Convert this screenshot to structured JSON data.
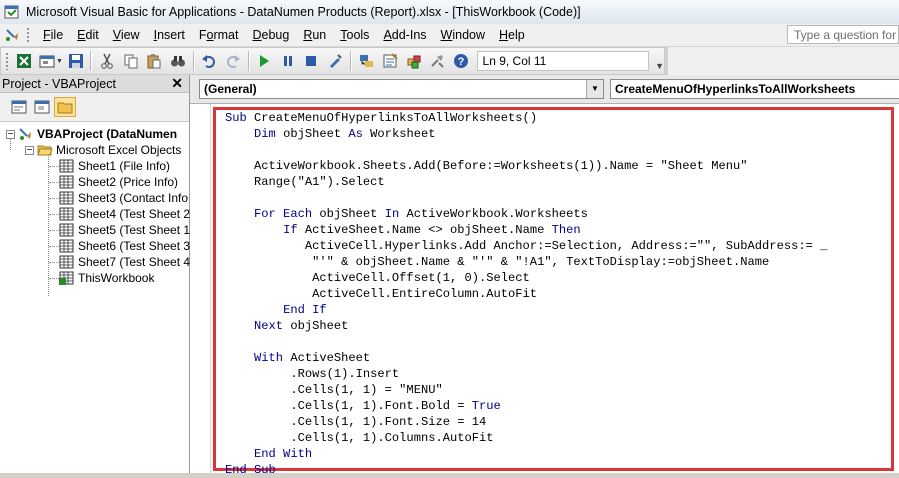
{
  "window": {
    "title": "Microsoft Visual Basic for Applications - DataNumen Products (Report).xlsx - [ThisWorkbook (Code)]",
    "app_icon": "vba-icon"
  },
  "menu": {
    "items": [
      {
        "id": "file",
        "label": "File",
        "u": "F",
        "rest": "ile"
      },
      {
        "id": "edit",
        "label": "Edit",
        "u": "E",
        "rest": "dit"
      },
      {
        "id": "view",
        "label": "View",
        "u": "V",
        "rest": "iew"
      },
      {
        "id": "insert",
        "label": "Insert",
        "u": "I",
        "rest": "nsert"
      },
      {
        "id": "format",
        "label": "Format",
        "u": "o",
        "pre": "F",
        "rest": "rmat"
      },
      {
        "id": "debug",
        "label": "Debug",
        "u": "D",
        "rest": "ebug"
      },
      {
        "id": "run",
        "label": "Run",
        "u": "R",
        "rest": "un"
      },
      {
        "id": "tools",
        "label": "Tools",
        "u": "T",
        "rest": "ools"
      },
      {
        "id": "addins",
        "label": "Add-Ins",
        "u": "A",
        "rest": "dd-Ins"
      },
      {
        "id": "window",
        "label": "Window",
        "u": "W",
        "rest": "indow"
      },
      {
        "id": "help",
        "label": "Help",
        "u": "H",
        "rest": "elp"
      }
    ],
    "ask_placeholder": "Type a question for"
  },
  "toolbar": {
    "position": "Ln 9, Col 11",
    "icons": [
      "view-excel-icon",
      "insert-userform-icon",
      "save-icon",
      "cut-icon",
      "copy-icon",
      "paste-icon",
      "find-icon",
      "undo-icon",
      "redo-icon",
      "run-icon",
      "break-icon",
      "reset-icon",
      "design-mode-icon",
      "project-explorer-icon",
      "properties-icon",
      "object-browser-icon",
      "toolbox-icon",
      "help-icon"
    ]
  },
  "project_panel": {
    "title": "Project - VBAProject",
    "close": "✕",
    "tree": {
      "root": "VBAProject (DataNumen",
      "folder": "Microsoft Excel Objects",
      "items": [
        "Sheet1 (File Info)",
        "Sheet2 (Price Info)",
        "Sheet3 (Contact Info",
        "Sheet4 (Test Sheet 2",
        "Sheet5 (Test Sheet 1",
        "Sheet6 (Test Sheet 3",
        "Sheet7 (Test Sheet 4",
        "ThisWorkbook"
      ]
    }
  },
  "code_window": {
    "object_combo": "(General)",
    "procedure_combo": "CreateMenuOfHyperlinksToAllWorksheets",
    "lines": [
      [
        {
          "k": "Sub "
        },
        {
          "t": "CreateMenuOfHyperlinksToAllWorksheets()"
        }
      ],
      [
        {
          "t": "    "
        },
        {
          "k": "Dim "
        },
        {
          "t": "objSheet "
        },
        {
          "k": "As "
        },
        {
          "t": "Worksheet"
        }
      ],
      [],
      [
        {
          "t": "    ActiveWorkbook.Sheets.Add(Before:=Worksheets(1)).Name = \"Sheet Menu\""
        }
      ],
      [
        {
          "t": "    Range(\"A1\").Select"
        }
      ],
      [],
      [
        {
          "t": "    "
        },
        {
          "k": "For Each "
        },
        {
          "t": "objSheet "
        },
        {
          "k": "In "
        },
        {
          "t": "ActiveWorkbook.Worksheets"
        }
      ],
      [
        {
          "t": "        "
        },
        {
          "k": "If "
        },
        {
          "t": "ActiveSheet.Name <> objSheet.Name "
        },
        {
          "k": "Then"
        }
      ],
      [
        {
          "t": "           ActiveCell.Hyperlinks.Add Anchor:=Selection, Address:=\"\", SubAddress:= _"
        }
      ],
      [
        {
          "t": "            \"'\" & objSheet.Name & \"'\" & \"!A1\", TextToDisplay:=objSheet.Name"
        }
      ],
      [
        {
          "t": "            ActiveCell.Offset(1, 0).Select"
        }
      ],
      [
        {
          "t": "            ActiveCell.EntireColumn.AutoFit"
        }
      ],
      [
        {
          "t": "        "
        },
        {
          "k": "End If"
        }
      ],
      [
        {
          "t": "    "
        },
        {
          "k": "Next "
        },
        {
          "t": "objSheet"
        }
      ],
      [],
      [
        {
          "t": "    "
        },
        {
          "k": "With "
        },
        {
          "t": "ActiveSheet"
        }
      ],
      [
        {
          "t": "         .Rows(1).Insert"
        }
      ],
      [
        {
          "t": "         .Cells(1, 1) = \"MENU\""
        }
      ],
      [
        {
          "t": "         .Cells(1, 1).Font.Bold = "
        },
        {
          "k": "True"
        }
      ],
      [
        {
          "t": "         .Cells(1, 1).Font.Size = 14"
        }
      ],
      [
        {
          "t": "         .Cells(1, 1).Columns.AutoFit"
        }
      ],
      [
        {
          "t": "    "
        },
        {
          "k": "End With"
        }
      ],
      [
        {
          "k": "End Sub"
        }
      ]
    ]
  },
  "colors": {
    "keyword": "#00008b",
    "highlight_border": "#d9363a"
  }
}
